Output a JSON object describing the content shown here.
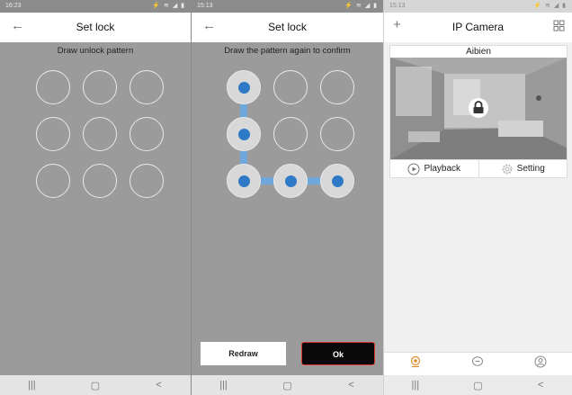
{
  "panel1": {
    "status_time": "16:23",
    "status_icons": "⚡ ≋ ◢ ▮",
    "back_icon": "←",
    "title": "Set lock",
    "prompt": "Draw unlock pattern",
    "pattern_selected": []
  },
  "panel2": {
    "status_time": "15:13",
    "status_icons": "⚡ ≋ ◢ ▮",
    "back_icon": "←",
    "title": "Set lock",
    "prompt": "Draw the pattern again to confirm",
    "pattern_selected": [
      0,
      3,
      6,
      7,
      8
    ],
    "redraw_label": "Redraw",
    "ok_label": "Ok"
  },
  "panel3": {
    "status_time": "15:13",
    "status_icons": "⚡ ≋ ◢ ▮",
    "add_icon": "+",
    "title": "IP Camera",
    "camera_name": "Aibien",
    "playback_label": "Playback",
    "setting_label": "Setting"
  },
  "navbar": {
    "recent": "|||",
    "home": "▢",
    "back": "<"
  },
  "colors": {
    "accent": "#2f7ac7",
    "ok_border": "#d9352a",
    "screen_bg": "#9b9b9b"
  }
}
